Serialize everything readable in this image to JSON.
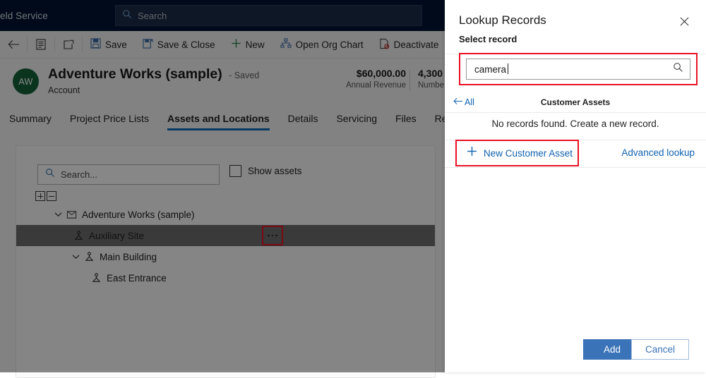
{
  "topbar": {
    "app_title": "eld Service",
    "search_placeholder": "Search",
    "search_icon": "search-icon",
    "background": "#001433"
  },
  "commandbar": {
    "back_icon": "back-arrow-icon",
    "form_icon": "form-icon",
    "popout_icon": "pop-out-icon",
    "buttons": [
      {
        "label": "Save",
        "icon": "save-icon"
      },
      {
        "label": "Save & Close",
        "icon": "save-and-close-icon"
      },
      {
        "label": "New",
        "icon": "plus-icon"
      },
      {
        "label": "Open Org Chart",
        "icon": "org-chart-icon"
      },
      {
        "label": "Deactivate",
        "icon": "deactivate-icon"
      }
    ],
    "overflow_icon": "more-commands-icon"
  },
  "record": {
    "avatar_initials": "AW",
    "avatar_color": "#16633a",
    "title": "Adventure Works (sample)",
    "saved_state": "- Saved",
    "entity_type": "Account",
    "metrics": [
      {
        "value": "$60,000.00",
        "label": "Annual Revenue"
      },
      {
        "value": "4,300",
        "label": "Numbe"
      }
    ]
  },
  "tabs": {
    "active": "Assets and Locations",
    "items": [
      "Summary",
      "Project Price Lists",
      "Assets and Locations",
      "Details",
      "Servicing",
      "Files",
      "Relate"
    ],
    "active_underline_color": "#0f6cbd"
  },
  "assets_panel": {
    "search_placeholder": "Search...",
    "search_icon": "search-icon",
    "show_assets_label": "Show assets",
    "show_assets_checked": false,
    "expand_all_icon": "expand-all-icon",
    "collapse_all_icon": "collapse-all-icon",
    "tree": [
      {
        "label": "Adventure Works (sample)",
        "icon": "account-icon",
        "indent": 0,
        "expanded": true,
        "selected": false,
        "has_chevron": true,
        "has_ellipsis": false
      },
      {
        "label": "Auxiliary Site",
        "icon": "functional-location-icon",
        "indent": 1,
        "expanded": false,
        "selected": true,
        "has_chevron": false,
        "has_ellipsis": true
      },
      {
        "label": "Main Building",
        "icon": "functional-location-icon",
        "indent": 1,
        "expanded": true,
        "selected": false,
        "has_chevron": true,
        "has_ellipsis": false
      },
      {
        "label": "East Entrance",
        "icon": "functional-location-icon",
        "indent": 2,
        "expanded": false,
        "selected": false,
        "has_chevron": false,
        "has_ellipsis": false
      }
    ],
    "ellipsis_icon": "more-options-icon",
    "highlight_color": "#e81123"
  },
  "lookup": {
    "title": "Lookup Records",
    "subtitle": "Select record",
    "close_icon": "close-icon",
    "search_value": "camera",
    "search_icon": "search-icon",
    "back_all_label": "All",
    "back_icon": "back-arrow-icon",
    "entity_name": "Customer Assets",
    "empty_message": "No records found. Create a new record.",
    "new_record_label": "New Customer Asset",
    "new_record_icon": "plus-icon",
    "advanced_lookup_label": "Advanced lookup",
    "add_label": "Add",
    "cancel_label": "Cancel",
    "accent_color": "#0f62b0",
    "primary_button_color": "#3a73b8",
    "highlight_color": "#e81123"
  }
}
